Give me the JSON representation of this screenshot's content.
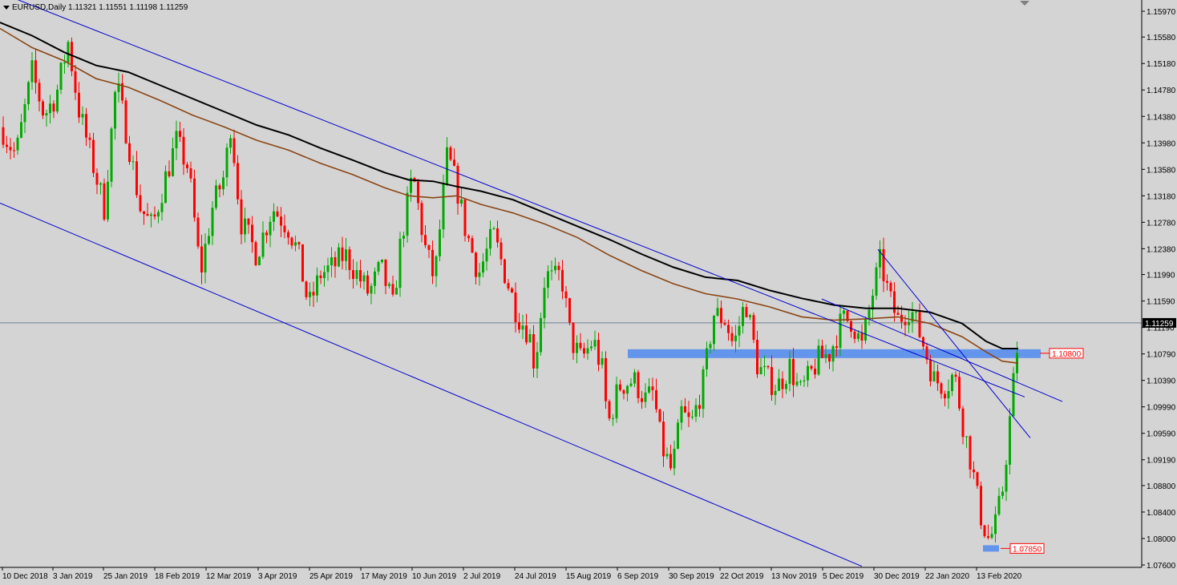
{
  "header": {
    "symbol": "EURUSD,Daily",
    "open": "1.11321",
    "high": "1.11551",
    "low": "1.11198",
    "close": "1.11259"
  },
  "axis": {
    "y_labels": [
      "1.15970",
      "1.15580",
      "1.15180",
      "1.14780",
      "1.14380",
      "1.13980",
      "1.13580",
      "1.13180",
      "1.12780",
      "1.12380",
      "1.11990",
      "1.11590",
      "1.11190",
      "1.10790",
      "1.10390",
      "1.09990",
      "1.09590",
      "1.09190",
      "1.08800",
      "1.08400",
      "1.08000",
      "1.07600"
    ],
    "current_price": "1.11259",
    "x_labels": [
      "10 Dec 2018",
      "3 Jan 2019",
      "25 Jan 2019",
      "18 Feb 2019",
      "12 Mar 2019",
      "3 Apr 2019",
      "25 Apr 2019",
      "17 May 2019",
      "10 Jun 2019",
      "2 Jul 2019",
      "24 Jul 2019",
      "15 Aug 2019",
      "6 Sep 2019",
      "30 Sep 2019",
      "22 Oct 2019",
      "13 Nov 2019",
      "5 Dec 2019",
      "30 Dec 2019",
      "22 Jan 2020",
      "13 Feb 2020"
    ]
  },
  "levels": {
    "resistance_label": "1.10800",
    "support_label": "1.07850"
  },
  "chart_data": {
    "type": "candlestick",
    "title": "EURUSD,Daily",
    "ylim": [
      1.0755,
      1.1615
    ],
    "y_ticks": [
      1.1597,
      1.1558,
      1.1518,
      1.1478,
      1.1438,
      1.1398,
      1.1358,
      1.1318,
      1.1278,
      1.1238,
      1.1199,
      1.1159,
      1.1119,
      1.1079,
      1.1039,
      1.0999,
      1.0959,
      1.0919,
      1.088,
      1.084,
      1.08,
      1.076
    ],
    "last_price": 1.11259,
    "zone_level": 1.108,
    "support_level": 1.0785,
    "colors": {
      "bull": "#00aa00",
      "bear": "#ff0000",
      "ma_fast": "#8b4513",
      "ma_slow": "#000000",
      "trend": "#0000cc",
      "zone": "#6495ed",
      "price_line": "#708090",
      "background": "#d4d4d4"
    },
    "anchors": [
      [
        0,
        1.1427
      ],
      [
        10,
        1.14
      ],
      [
        20,
        1.138
      ],
      [
        40,
        1.1505
      ],
      [
        55,
        1.144
      ],
      [
        70,
        1.147
      ],
      [
        85,
        1.155
      ],
      [
        98,
        1.145
      ],
      [
        115,
        1.137
      ],
      [
        130,
        1.13
      ],
      [
        145,
        1.149
      ],
      [
        160,
        1.14
      ],
      [
        175,
        1.13
      ],
      [
        190,
        1.127
      ],
      [
        205,
        1.134
      ],
      [
        220,
        1.14
      ],
      [
        235,
        1.136
      ],
      [
        250,
        1.12
      ],
      [
        265,
        1.13
      ],
      [
        280,
        1.135
      ],
      [
        288,
        1.143
      ],
      [
        300,
        1.128
      ],
      [
        320,
        1.123
      ],
      [
        340,
        1.13
      ],
      [
        360,
        1.127
      ],
      [
        372,
        1.123
      ],
      [
        385,
        1.115
      ],
      [
        400,
        1.12
      ],
      [
        415,
        1.121
      ],
      [
        430,
        1.123
      ],
      [
        445,
        1.12
      ],
      [
        460,
        1.117
      ],
      [
        475,
        1.121
      ],
      [
        490,
        1.115
      ],
      [
        500,
        1.125
      ],
      [
        515,
        1.135
      ],
      [
        530,
        1.124
      ],
      [
        542,
        1.119
      ],
      [
        558,
        1.138
      ],
      [
        570,
        1.133
      ],
      [
        580,
        1.127
      ],
      [
        597,
        1.12
      ],
      [
        615,
        1.126
      ],
      [
        630,
        1.12
      ],
      [
        645,
        1.114
      ],
      [
        660,
        1.111
      ],
      [
        667,
        1.106
      ],
      [
        680,
        1.12
      ],
      [
        690,
        1.119
      ],
      [
        700,
        1.12
      ],
      [
        712,
        1.11
      ],
      [
        725,
        1.107
      ],
      [
        740,
        1.11
      ],
      [
        752,
        1.105
      ],
      [
        758,
        1.097
      ],
      [
        772,
        1.103
      ],
      [
        790,
        1.104
      ],
      [
        805,
        1.101
      ],
      [
        815,
        1.102
      ],
      [
        825,
        1.094
      ],
      [
        838,
        1.09
      ],
      [
        850,
        1.099
      ],
      [
        862,
        1.097
      ],
      [
        878,
        1.104
      ],
      [
        890,
        1.114
      ],
      [
        905,
        1.113
      ],
      [
        915,
        1.109
      ],
      [
        930,
        1.116
      ],
      [
        945,
        1.106
      ],
      [
        958,
        1.104
      ],
      [
        970,
        1.103
      ],
      [
        985,
        1.106
      ],
      [
        998,
        1.102
      ],
      [
        1012,
        1.105
      ],
      [
        1020,
        1.107
      ],
      [
        1035,
        1.108
      ],
      [
        1050,
        1.113
      ],
      [
        1062,
        1.113
      ],
      [
        1075,
        1.109
      ],
      [
        1090,
        1.118
      ],
      [
        1098,
        1.122
      ],
      [
        1110,
        1.116
      ],
      [
        1120,
        1.113
      ],
      [
        1135,
        1.115
      ],
      [
        1150,
        1.11
      ],
      [
        1165,
        1.104
      ],
      [
        1180,
        1.103
      ],
      [
        1190,
        1.105
      ],
      [
        1200,
        1.098
      ],
      [
        1212,
        1.091
      ],
      [
        1222,
        1.084
      ],
      [
        1232,
        1.08
      ],
      [
        1240,
        1.081
      ],
      [
        1250,
        1.087
      ],
      [
        1258,
        1.096
      ],
      [
        1266,
        1.106
      ],
      [
        1272,
        1.1125
      ]
    ],
    "ma_slow": [
      [
        0,
        1.158
      ],
      [
        40,
        1.156
      ],
      [
        80,
        1.1535
      ],
      [
        120,
        1.1515
      ],
      [
        160,
        1.1505
      ],
      [
        200,
        1.1485
      ],
      [
        240,
        1.1465
      ],
      [
        280,
        1.1445
      ],
      [
        320,
        1.1425
      ],
      [
        360,
        1.141
      ],
      [
        400,
        1.139
      ],
      [
        440,
        1.1372
      ],
      [
        480,
        1.1353
      ],
      [
        510,
        1.1342
      ],
      [
        540,
        1.134
      ],
      [
        570,
        1.1332
      ],
      [
        600,
        1.1325
      ],
      [
        640,
        1.1312
      ],
      [
        680,
        1.1292
      ],
      [
        720,
        1.1272
      ],
      [
        760,
        1.1252
      ],
      [
        800,
        1.123
      ],
      [
        840,
        1.121
      ],
      [
        880,
        1.1195
      ],
      [
        920,
        1.119
      ],
      [
        960,
        1.1175
      ],
      [
        1000,
        1.1163
      ],
      [
        1040,
        1.1153
      ],
      [
        1080,
        1.1148
      ],
      [
        1120,
        1.1148
      ],
      [
        1160,
        1.1142
      ],
      [
        1200,
        1.1125
      ],
      [
        1230,
        1.1098
      ],
      [
        1250,
        1.1087
      ],
      [
        1270,
        1.1087
      ]
    ],
    "ma_fast": [
      [
        0,
        1.1571
      ],
      [
        40,
        1.1542
      ],
      [
        80,
        1.1522
      ],
      [
        120,
        1.1495
      ],
      [
        160,
        1.1482
      ],
      [
        200,
        1.1462
      ],
      [
        240,
        1.144
      ],
      [
        280,
        1.1422
      ],
      [
        320,
        1.1402
      ],
      [
        360,
        1.1387
      ],
      [
        400,
        1.1367
      ],
      [
        440,
        1.135
      ],
      [
        480,
        1.133
      ],
      [
        510,
        1.1318
      ],
      [
        540,
        1.1315
      ],
      [
        570,
        1.1318
      ],
      [
        600,
        1.1305
      ],
      [
        640,
        1.1292
      ],
      [
        680,
        1.1275
      ],
      [
        720,
        1.1255
      ],
      [
        760,
        1.1228
      ],
      [
        800,
        1.1205
      ],
      [
        840,
        1.1185
      ],
      [
        880,
        1.117
      ],
      [
        920,
        1.1162
      ],
      [
        960,
        1.115
      ],
      [
        1000,
        1.1135
      ],
      [
        1040,
        1.113
      ],
      [
        1080,
        1.1132
      ],
      [
        1120,
        1.1135
      ],
      [
        1160,
        1.1125
      ],
      [
        1200,
        1.1105
      ],
      [
        1230,
        1.1082
      ],
      [
        1250,
        1.1068
      ],
      [
        1270,
        1.1065
      ]
    ],
    "trendlines": [
      [
        [
          0,
          1.1625
        ],
        [
          1278,
          1.1014
        ]
      ],
      [
        [
          0,
          1.1307
        ],
        [
          1075,
          1.0758
        ]
      ],
      [
        [
          1095,
          1.1237
        ],
        [
          1285,
          1.0952
        ]
      ],
      [
        [
          1025,
          1.1162
        ],
        [
          1325,
          1.1007
        ]
      ]
    ]
  }
}
